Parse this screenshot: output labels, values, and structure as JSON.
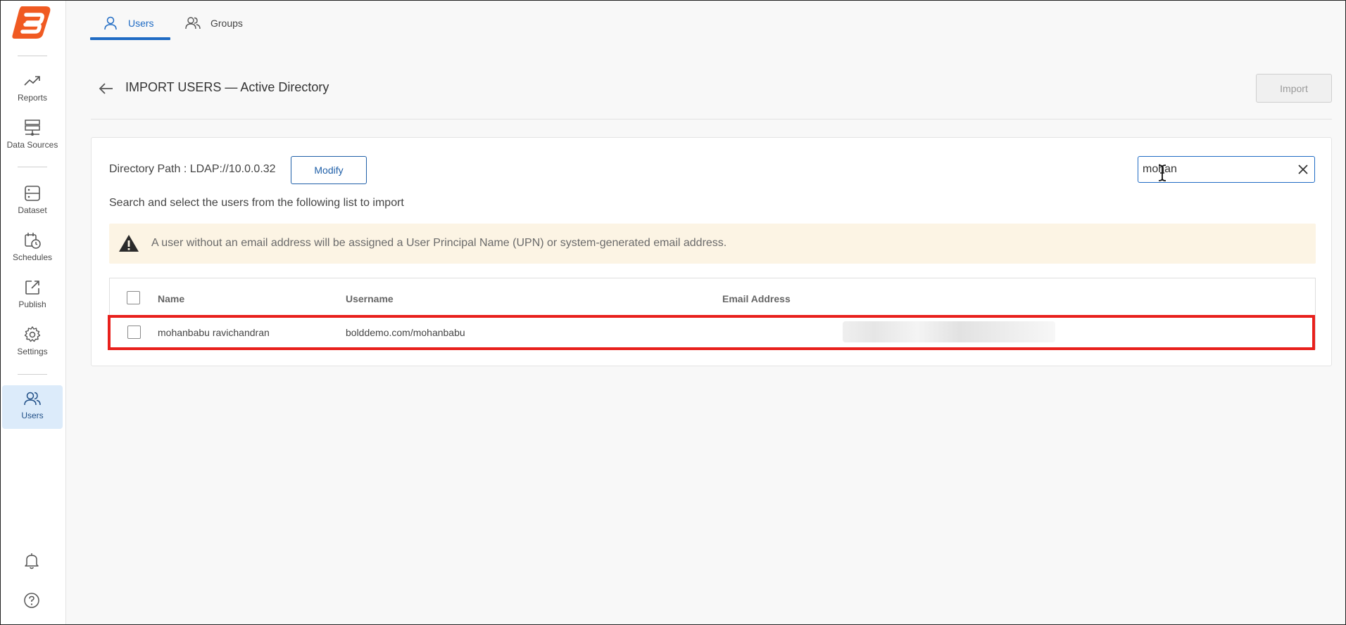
{
  "sidebar": {
    "logo_icon": "boldreports-logo",
    "brand_color": "#f05a22",
    "items": [
      {
        "label": "Reports",
        "icon": "trending-up-icon"
      },
      {
        "label": "Data Sources",
        "icon": "database-server-icon"
      },
      {
        "label": "Dataset",
        "icon": "dataset-icon"
      },
      {
        "label": "Schedules",
        "icon": "calendar-clock-icon"
      },
      {
        "label": "Publish",
        "icon": "publish-icon"
      },
      {
        "label": "Settings",
        "icon": "gear-icon"
      },
      {
        "label": "Users",
        "icon": "users-icon",
        "active": true
      }
    ],
    "bottom": [
      {
        "icon": "bell-icon"
      },
      {
        "icon": "help-icon"
      }
    ]
  },
  "tabs": [
    {
      "label": "Users",
      "icon": "user-icon",
      "active": true
    },
    {
      "label": "Groups",
      "icon": "group-icon"
    }
  ],
  "header": {
    "title": "IMPORT USERS — Active Directory",
    "import_label": "Import"
  },
  "directory": {
    "path_label": "Directory Path : LDAP://10.0.0.32",
    "modify_label": "Modify"
  },
  "search": {
    "value": "mohan"
  },
  "instruction": "Search and select the users from the following list to import",
  "alert": {
    "text": "A user without an email address will be assigned a User Principal Name (UPN) or system-generated email address.",
    "icon": "warning-icon"
  },
  "table": {
    "columns": [
      "Name",
      "Username",
      "Email Address"
    ],
    "rows": [
      {
        "name": "mohanbabu ravichandran",
        "username": "bolddemo.com/mohanbabu",
        "email": ""
      }
    ]
  },
  "colors": {
    "accent": "#1f6bc4",
    "highlight": "#e8201c",
    "alert_bg": "#fcf4e4"
  }
}
